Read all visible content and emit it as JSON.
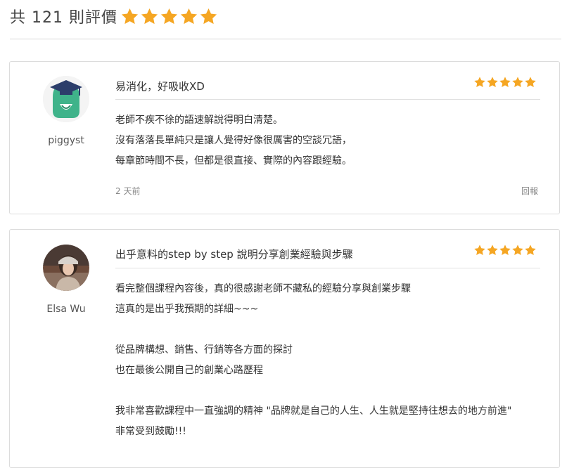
{
  "summary": {
    "label": "共 121 則評價",
    "rating_stars": 5
  },
  "reviews": [
    {
      "author_name": "piggyst",
      "avatar": "graduation-cap-mascot-icon",
      "title": "易消化，好吸收XD",
      "rating_stars": 5,
      "body": [
        "老師不疾不徐的語速解說得明白清楚。",
        "沒有落落長單純只是讓人覺得好像很厲害的空談冗語，",
        "每章節時間不長，但都是很直接、實際的內容跟經驗。"
      ],
      "time": "2 天前",
      "report_label": "回報"
    },
    {
      "author_name": "Elsa Wu",
      "avatar": "user-photo",
      "title": "出乎意料的step by step 說明分享創業經驗與步驟",
      "rating_stars": 5,
      "body": [
        "看完整個課程內容後，真的很感謝老師不藏私的經驗分享與創業步驟",
        "這真的是出乎我預期的詳細~~~",
        "",
        "從品牌構想、銷售、行銷等各方面的探討",
        "也在最後公開自己的創業心路歷程",
        "",
        "我非常喜歡課程中一直強調的精神 \"品牌就是自己的人生、人生就是堅持往想去的地方前進\"",
        "非常受到鼓勵!!!"
      ]
    }
  ],
  "colors": {
    "star": "#f5a623",
    "text": "#333333",
    "muted": "#888888",
    "border": "#dcdcdc",
    "mascot_green": "#3fb38a",
    "cap_navy": "#2c3e6b"
  }
}
